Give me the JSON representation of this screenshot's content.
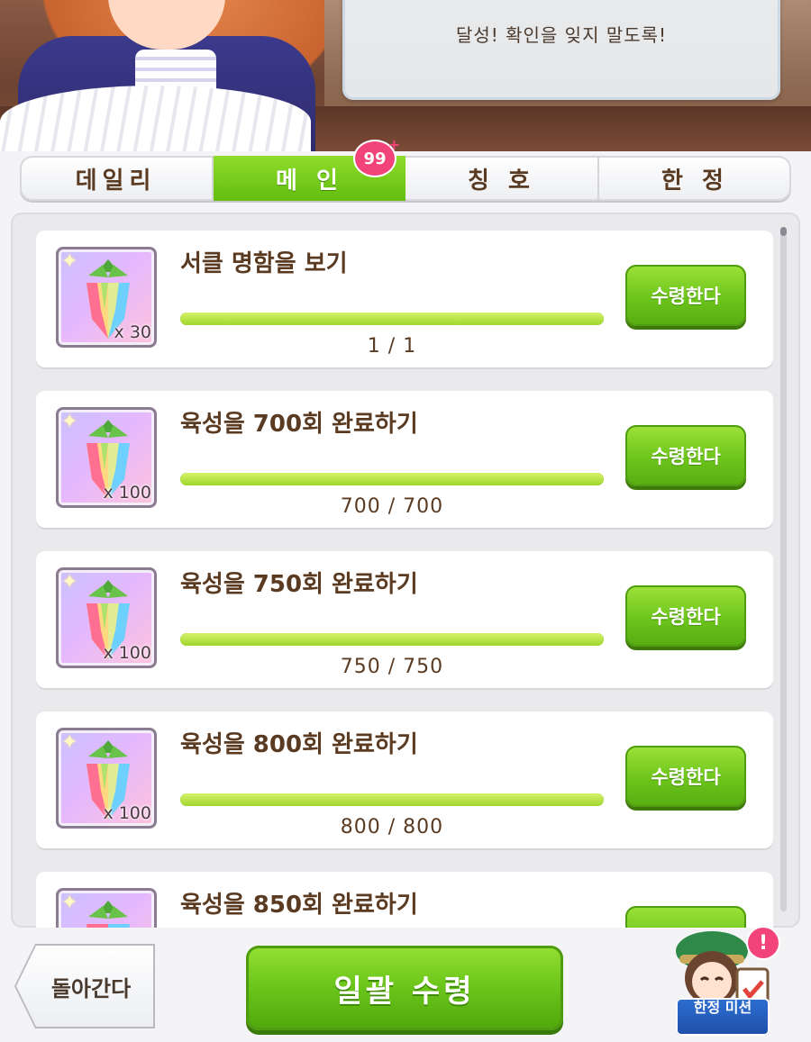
{
  "speech": {
    "text": "달성! 확인을 잊지 말도록!"
  },
  "tabs": [
    {
      "label": "데일리",
      "active": false
    },
    {
      "label": "메 인",
      "active": true,
      "badge": "99"
    },
    {
      "label": "칭 호",
      "active": false
    },
    {
      "label": "한 정",
      "active": false
    }
  ],
  "missions": [
    {
      "title": "서클 명함을 보기",
      "reward_qty": "x 30",
      "progress_text": "1 / 1",
      "progress": 1.0,
      "button": "수령한다"
    },
    {
      "title": "육성을 700회 완료하기",
      "reward_qty": "x 100",
      "progress_text": "700 / 700",
      "progress": 1.0,
      "button": "수령한다"
    },
    {
      "title": "육성을 750회 완료하기",
      "reward_qty": "x 100",
      "progress_text": "750 / 750",
      "progress": 1.0,
      "button": "수령한다"
    },
    {
      "title": "육성을 800회 완료하기",
      "reward_qty": "x 100",
      "progress_text": "800 / 800",
      "progress": 1.0,
      "button": "수령한다"
    },
    {
      "title": "육성을 850회 완료하기"
    }
  ],
  "bottom": {
    "back_label": "돌아간다",
    "claim_all_label": "일괄 수령",
    "limited_mission_label": "한정 미션",
    "alert": "!"
  },
  "colors": {
    "accent_green": "#6cc41a",
    "badge_pink": "#f2437a",
    "text_brown": "#5a3b22"
  },
  "icons": [
    "carrot-gem-icon",
    "sparkle-icon",
    "alert-icon"
  ]
}
